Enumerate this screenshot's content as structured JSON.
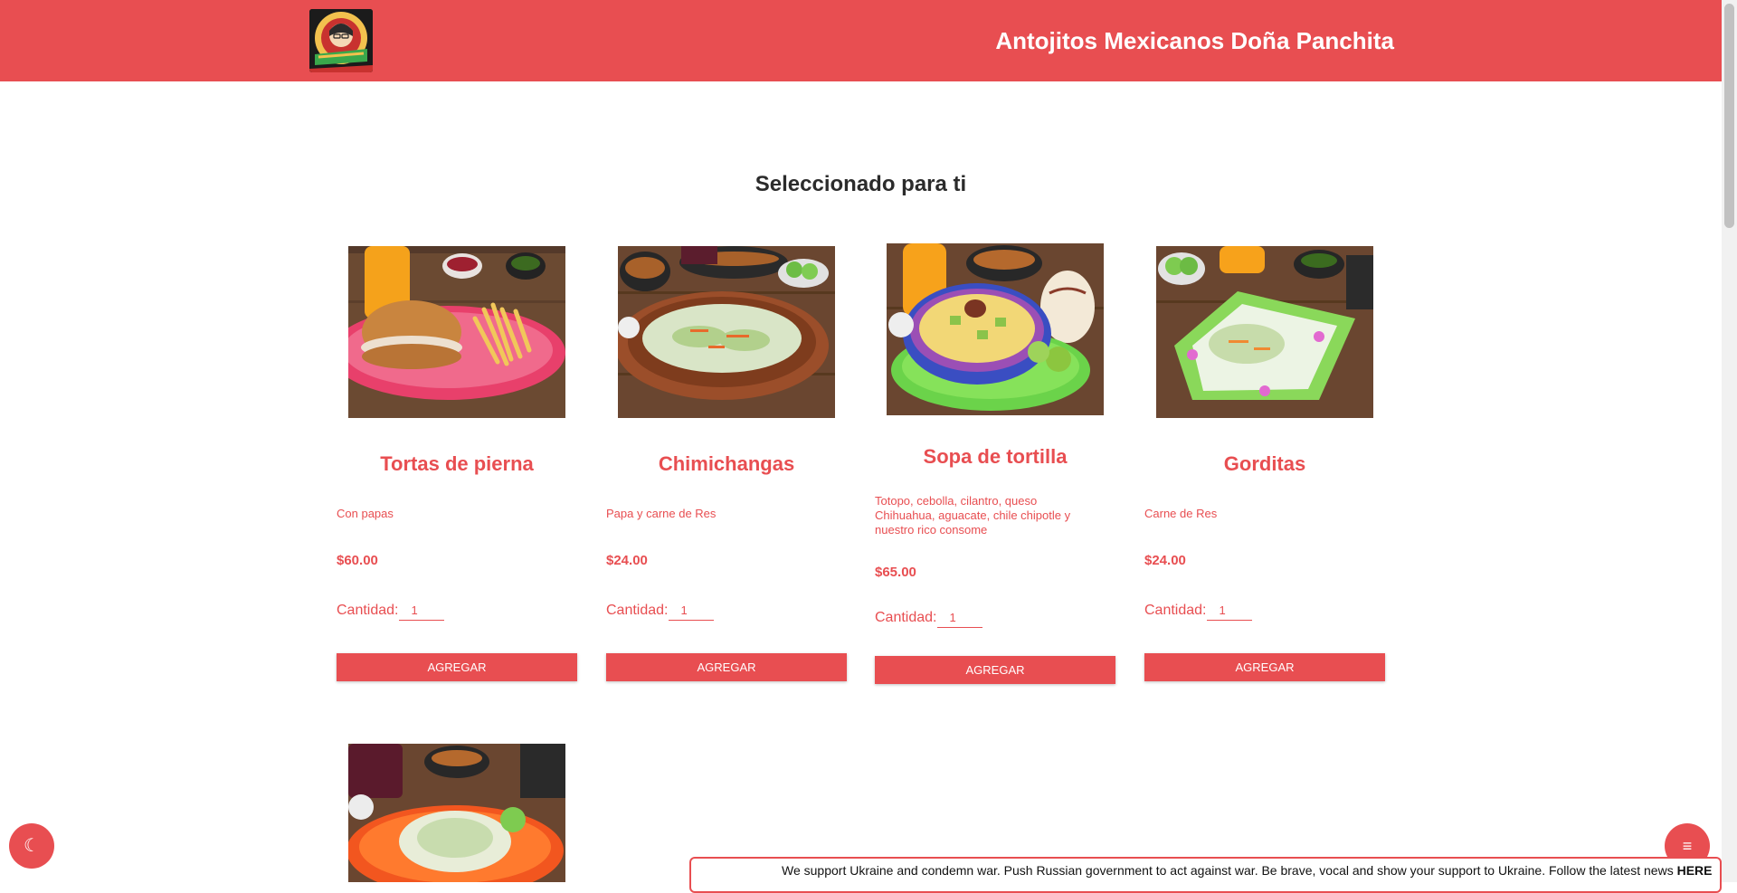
{
  "header": {
    "title": "Antojitos Mexicanos Doña Panchita",
    "logo_name": "dona-panchita-logo"
  },
  "section": {
    "title": "Seleccionado para ti"
  },
  "products": [
    {
      "name": "Tortas de pierna",
      "description": "Con papas",
      "price": "$60.00",
      "qty_label": "Cantidad:",
      "qty": "1",
      "button": "AGREGAR"
    },
    {
      "name": "Chimichangas",
      "description": "Papa y carne de Res",
      "price": "$24.00",
      "qty_label": "Cantidad:",
      "qty": "1",
      "button": "AGREGAR"
    },
    {
      "name": "Sopa de tortilla",
      "description": "Totopo, cebolla, cilantro, queso Chihuahua, aguacate, chile chipotle y nuestro rico consome",
      "price": "$65.00",
      "qty_label": "Cantidad:",
      "qty": "1",
      "button": "AGREGAR"
    },
    {
      "name": "Gorditas",
      "description": "Carne de Res",
      "price": "$24.00",
      "qty_label": "Cantidad:",
      "qty": "1",
      "button": "AGREGAR"
    }
  ],
  "floating": {
    "theme_icon": "moon-icon",
    "menu_icon": "menu-icon"
  },
  "banner": {
    "text": "We support Ukraine and condemn war. Push Russian government to act against war. Be brave, vocal and show your support to Ukraine. Follow the latest news ",
    "link": "HERE"
  },
  "colors": {
    "brand": "#e84e51",
    "background": "#ffffff"
  }
}
